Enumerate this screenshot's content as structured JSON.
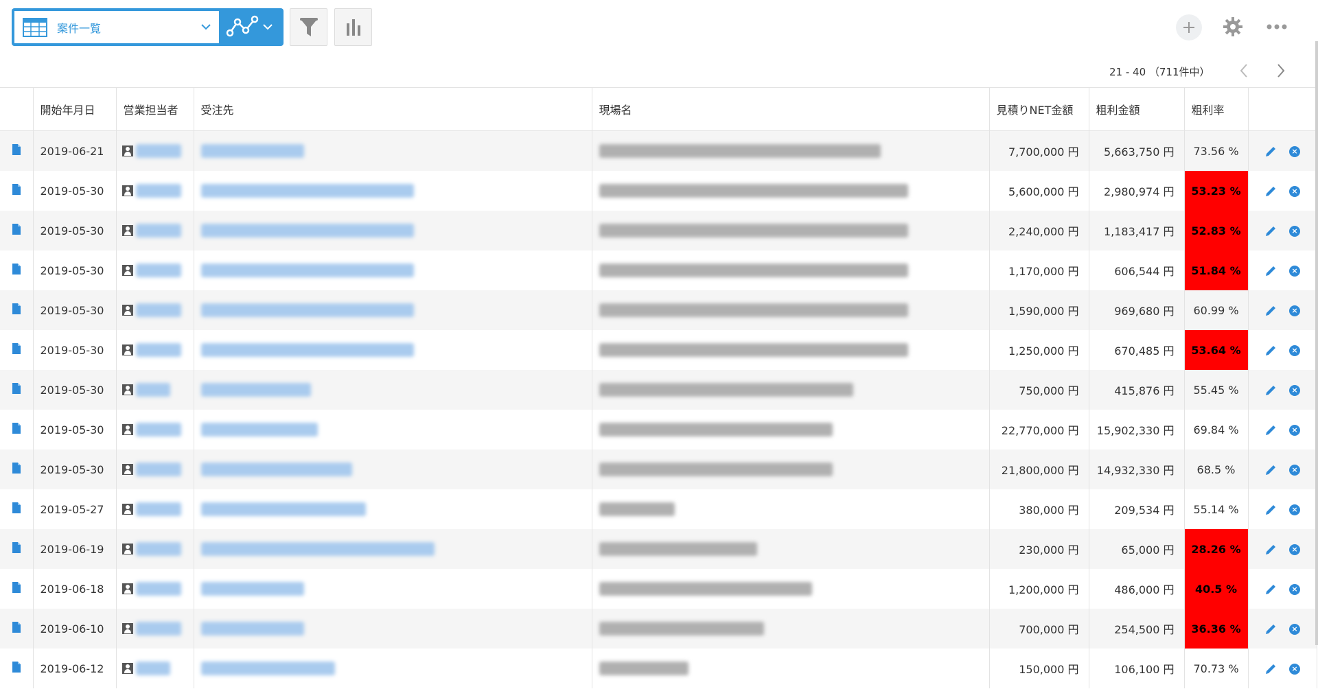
{
  "toolbar": {
    "view_name": "案件一覧"
  },
  "pager": {
    "range_text": "21 - 40 （711件中）"
  },
  "table": {
    "headers": {
      "start_date": "開始年月日",
      "owner": "営業担当者",
      "customer": "受注先",
      "site": "現場名",
      "estimate": "見積りNET金額",
      "profit": "粗利金額",
      "rate": "粗利率"
    },
    "rows": [
      {
        "date": "2019-06-21",
        "estimate": "7,700,000 円",
        "profit": "5,663,750 円",
        "rate": "73.56 %",
        "low": false
      },
      {
        "date": "2019-05-30",
        "estimate": "5,600,000 円",
        "profit": "2,980,974 円",
        "rate": "53.23 %",
        "low": true
      },
      {
        "date": "2019-05-30",
        "estimate": "2,240,000 円",
        "profit": "1,183,417 円",
        "rate": "52.83 %",
        "low": true
      },
      {
        "date": "2019-05-30",
        "estimate": "1,170,000 円",
        "profit": "606,544 円",
        "rate": "51.84 %",
        "low": true
      },
      {
        "date": "2019-05-30",
        "estimate": "1,590,000 円",
        "profit": "969,680 円",
        "rate": "60.99 %",
        "low": false
      },
      {
        "date": "2019-05-30",
        "estimate": "1,250,000 円",
        "profit": "670,485 円",
        "rate": "53.64 %",
        "low": true
      },
      {
        "date": "2019-05-30",
        "estimate": "750,000 円",
        "profit": "415,876 円",
        "rate": "55.45 %",
        "low": false
      },
      {
        "date": "2019-05-30",
        "estimate": "22,770,000 円",
        "profit": "15,902,330 円",
        "rate": "69.84 %",
        "low": false
      },
      {
        "date": "2019-05-30",
        "estimate": "21,800,000 円",
        "profit": "14,932,330 円",
        "rate": "68.5 %",
        "low": false
      },
      {
        "date": "2019-05-27",
        "estimate": "380,000 円",
        "profit": "209,534 円",
        "rate": "55.14 %",
        "low": false
      },
      {
        "date": "2019-06-19",
        "estimate": "230,000 円",
        "profit": "65,000 円",
        "rate": "28.26 %",
        "low": true
      },
      {
        "date": "2019-06-18",
        "estimate": "1,200,000 円",
        "profit": "486,000 円",
        "rate": "40.5 %",
        "low": true
      },
      {
        "date": "2019-06-10",
        "estimate": "700,000 円",
        "profit": "254,500 円",
        "rate": "36.36 %",
        "low": true
      },
      {
        "date": "2019-06-12",
        "estimate": "150,000 円",
        "profit": "106,100 円",
        "rate": "70.73 %",
        "low": false
      }
    ]
  },
  "colors": {
    "accent": "#3498db",
    "low_rate_bg": "#ff0000",
    "row_alt": "#f5f5f5"
  }
}
